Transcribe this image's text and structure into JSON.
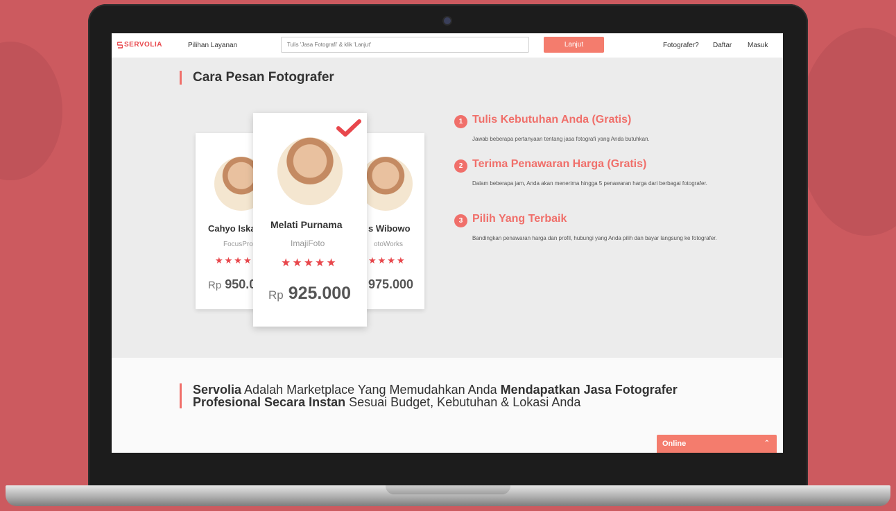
{
  "header": {
    "logo_text": "SERVOLIA",
    "services_label": "Pilihan Layanan",
    "search_placeholder": "Tulis 'Jasa Fotografi' & klik 'Lanjut'",
    "next_button": "Lanjut",
    "photographer_link": "Fotografer?",
    "register_link": "Daftar",
    "login_link": "Masuk"
  },
  "section": {
    "title": "Cara Pesan Fotografer"
  },
  "cards": [
    {
      "name": "Cahyo Iska",
      "company": "FocusPro",
      "stars": "★★★★",
      "currency": "Rp",
      "price": "950.0"
    },
    {
      "name": "Melati Purnama",
      "company": "ImajiFoto",
      "stars": "★★★★★",
      "currency": "Rp",
      "price": "925.000"
    },
    {
      "name": "s Wibowo",
      "company": "otoWorks",
      "stars": "★★★★",
      "currency": "",
      "price": "975.000"
    }
  ],
  "steps": [
    {
      "num": "1",
      "title": "Tulis Kebutuhan Anda (Gratis)",
      "desc": "Jawab beberapa pertanyaan tentang jasa fotografi yang Anda butuhkan."
    },
    {
      "num": "2",
      "title": "Terima Penawaran Harga (Gratis)",
      "desc": "Dalam beberapa jam, Anda akan menerima hingga 5 penawaran harga dari berbagai fotografer."
    },
    {
      "num": "3",
      "title": "Pilih Yang Terbaik",
      "desc": "Bandingkan penawaran harga dan profil, hubungi yang Anda pilih dan bayar langsung ke fotografer."
    }
  ],
  "tagline": {
    "part1": "Servolia",
    "part2": " Adalah Marketplace Yang Memudahkan Anda ",
    "part3": "Mendapatkan Jasa Fotografer Profesional Secara Instan",
    "part4": " Sesuai Budget, Kebutuhan & Lokasi Anda"
  },
  "chat": {
    "label": "Online",
    "chevron": "⌃"
  },
  "colors": {
    "accent": "#f06f6a",
    "background": "#cc5a5f"
  }
}
